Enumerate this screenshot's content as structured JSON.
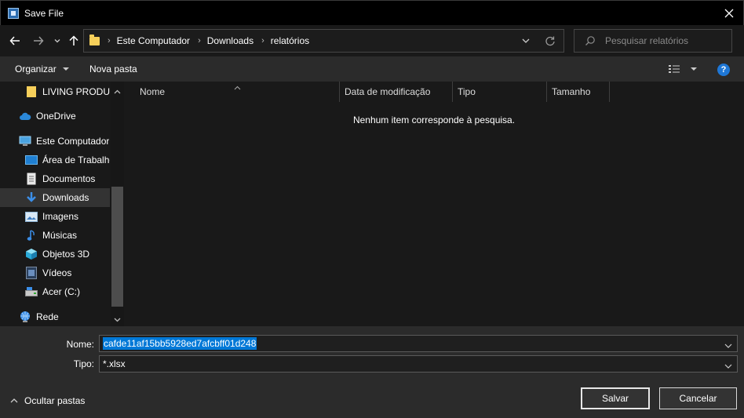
{
  "window": {
    "title": "Save File"
  },
  "address": {
    "crumbs": [
      "Este Computador",
      "Downloads",
      "relatórios"
    ],
    "search_placeholder": "Pesquisar relatórios"
  },
  "toolbar": {
    "organize": "Organizar",
    "new_folder": "Nova pasta",
    "help": "?"
  },
  "sidebar": {
    "items": [
      {
        "label": "LIVING PRODUÇ",
        "icon": "folder-icon"
      },
      {
        "label": "OneDrive",
        "icon": "cloud-icon"
      },
      {
        "label": "Este Computador",
        "icon": "computer-icon"
      },
      {
        "label": "Área de Trabalho",
        "icon": "desktop-icon"
      },
      {
        "label": "Documentos",
        "icon": "document-icon"
      },
      {
        "label": "Downloads",
        "icon": "download-icon",
        "selected": true
      },
      {
        "label": "Imagens",
        "icon": "image-icon"
      },
      {
        "label": "Músicas",
        "icon": "music-icon"
      },
      {
        "label": "Objetos 3D",
        "icon": "cube-icon"
      },
      {
        "label": "Vídeos",
        "icon": "video-icon"
      },
      {
        "label": "Acer (C:)",
        "icon": "drive-icon"
      },
      {
        "label": "Rede",
        "icon": "network-icon"
      }
    ]
  },
  "content": {
    "columns": [
      "Nome",
      "Data de modificação",
      "Tipo",
      "Tamanho"
    ],
    "empty_message": "Nenhum item corresponde à pesquisa."
  },
  "form": {
    "name_label": "Nome:",
    "name_value": "cafde11af15bb5928ed7afcbff01d248",
    "type_label": "Tipo:",
    "type_value": "*.xlsx",
    "hide_folders": "Ocultar pastas",
    "save": "Salvar",
    "cancel": "Cancelar"
  },
  "colors": {
    "accent": "#0078d7",
    "help": "#1e77d6",
    "folder": "#f6cf5a"
  }
}
